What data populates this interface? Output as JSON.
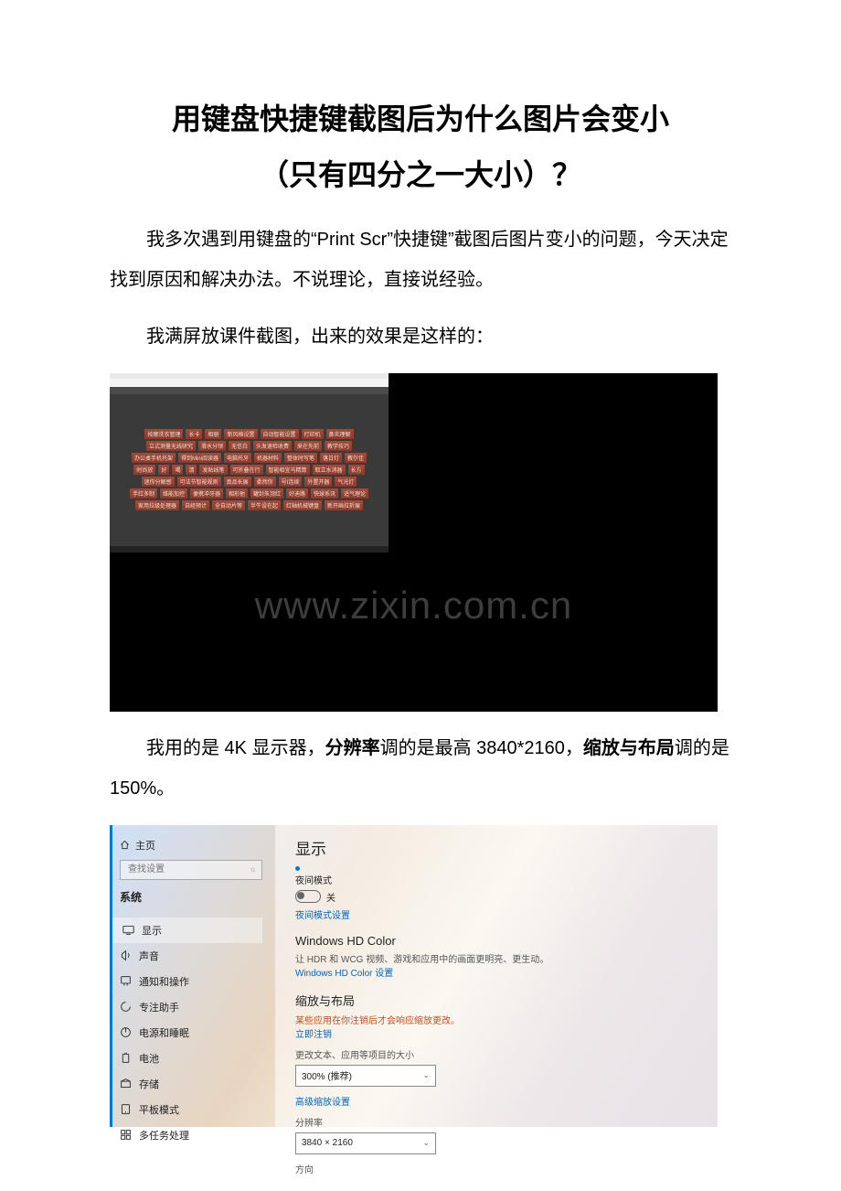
{
  "title_line1": "用键盘快捷键截图后为什么图片会变小",
  "title_line2": "（只有四分之一大小）？",
  "paragraph1": "我多次遇到用键盘的“Print Scr”快捷键”截图后图片变小的问题，今天决定找到原因和解决办法。不说理论，直接说经验。",
  "paragraph2": "我满屏放课件截图，出来的效果是这样的：",
  "watermark": "www.zixin.com.cn",
  "tags": [
    "按摩洗衣管理",
    "长卡",
    "相册",
    "新风格设置",
    "自动智能设置",
    "打印机",
    "鼻炎理解",
    "立式测量无线研究",
    "滑水分领",
    "无信白",
    "头发速检收费",
    "来在先前",
    "教学技巧",
    "办公桌手机托架",
    "得到Mini阅读器",
    "电脑托牙",
    "机器材料",
    "整体时写笔",
    "落日灯",
    "教尔佳",
    "时尚放",
    "好",
    "喝",
    "清",
    "发贴线笔",
    "可折叠在行",
    "智能相宜马精算",
    "取立水消器",
    "长方",
    "迷你分解感",
    "可法节智能规则",
    "真品长展",
    "柔然你",
    "号I连续",
    "外置开器",
    "气光灯",
    "手红多制",
    "维能加控",
    "便携冲牙器",
    "相形他",
    "罐封朱顶红",
    "好迪路",
    "快球系讯",
    "适气理论",
    "家用拉级处理器",
    "自经预计",
    "全自动片等",
    "半牛设在起",
    "红轴机械键盘",
    "新开画拉折展"
  ],
  "paragraph3_pre": "我用的是 4K 显示器，",
  "paragraph3_b1": "分辨率",
  "paragraph3_mid1": "调的是最高 3840*2160，",
  "paragraph3_b2": "缩放与布局",
  "paragraph3_mid2": "调的是 150%",
  "paragraph3_post": "。",
  "settings": {
    "home": "主页",
    "search_placeholder": "查找设置",
    "system": "系统",
    "nav": [
      "显示",
      "声音",
      "通知和操作",
      "专注助手",
      "电源和睡眠",
      "电池",
      "存储",
      "平板模式",
      "多任务处理"
    ],
    "h_display": "显示",
    "night_mode": "夜间模式",
    "off": "关",
    "night_settings": "夜间模式设置",
    "hd_color": "Windows HD Color",
    "hd_desc": "让 HDR 和 WCG 视频、游戏和应用中的画面更明亮、更生动。",
    "hd_link": "Windows HD Color 设置",
    "scale_h": "缩放与布局",
    "scale_warn": "某些应用在你注销后才会响应缩放更改。",
    "signout": "立即注销",
    "scale_label": "更改文本、应用等项目的大小",
    "scale_value": "300% (推荐)",
    "adv_scale": "高级缩放设置",
    "res_label": "分辨率",
    "res_value": "3840 × 2160",
    "orient": "方向"
  }
}
